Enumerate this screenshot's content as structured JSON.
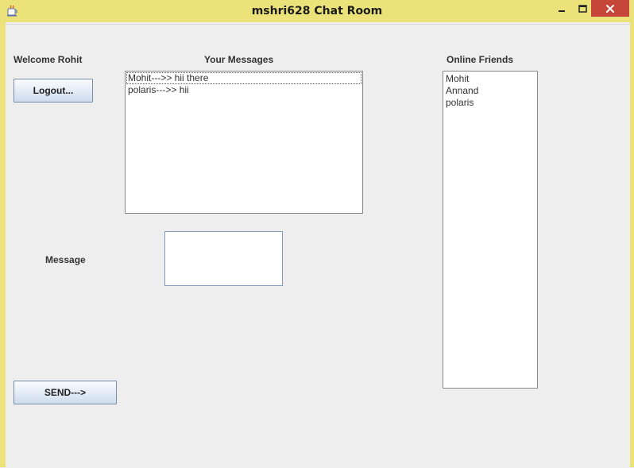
{
  "window": {
    "title": "mshri628 Chat Room"
  },
  "header": {
    "welcome": "Welcome Rohit",
    "messages_heading": "Your Messages",
    "friends_heading": "Online Friends"
  },
  "buttons": {
    "logout": "Logout...",
    "send": "SEND--->"
  },
  "messages": [
    "Mohit--->> hii there",
    "polaris--->> hii"
  ],
  "friends": [
    "Mohit",
    "Annand",
    "polaris"
  ],
  "composer": {
    "label": "Message",
    "value": ""
  },
  "icons": {
    "app": "java-cup-icon",
    "minimize": "minimize-icon",
    "maximize": "maximize-icon",
    "close": "close-icon"
  },
  "colors": {
    "title_bar": "#ece27a",
    "close_button": "#c7463a",
    "background": "#eeeeee"
  }
}
